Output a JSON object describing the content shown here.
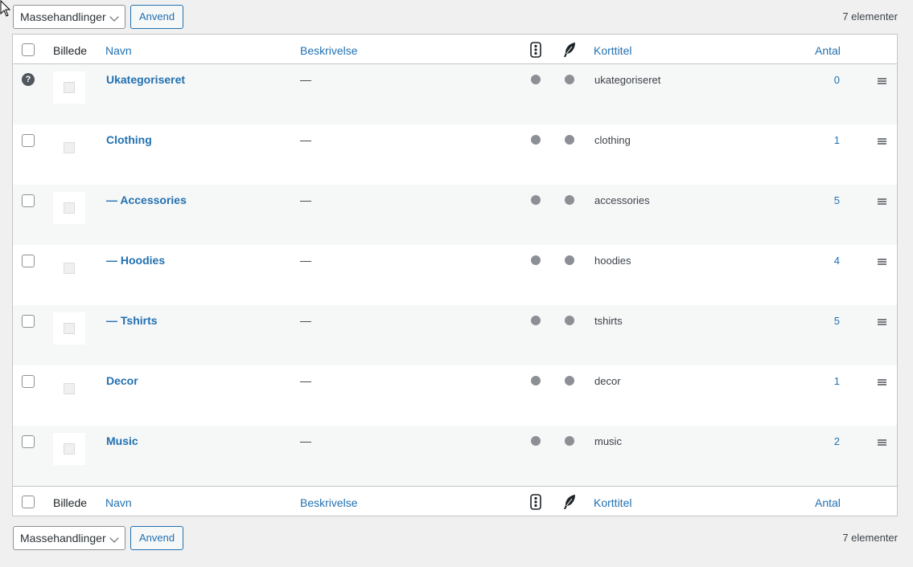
{
  "tablenav_top": {
    "bulk_actions": "Massehandlinger",
    "apply": "Anvend",
    "item_count": "7 elementer"
  },
  "tablenav_bottom": {
    "bulk_actions": "Massehandlinger",
    "apply": "Anvend",
    "item_count": "7 elementer"
  },
  "columns": {
    "image": "Billede",
    "name": "Navn",
    "description": "Beskrivelse",
    "slug": "Korttitel",
    "count": "Antal",
    "icon1": "traffic-light-icon",
    "icon2": "feather-icon"
  },
  "rows": [
    {
      "name": "Ukategoriseret",
      "description": "—",
      "slug": "ukategoriseret",
      "count": "0"
    },
    {
      "name": "Clothing",
      "description": "—",
      "slug": "clothing",
      "count": "1"
    },
    {
      "name": "— Accessories",
      "description": "—",
      "slug": "accessories",
      "count": "5"
    },
    {
      "name": "— Hoodies",
      "description": "—",
      "slug": "hoodies",
      "count": "4"
    },
    {
      "name": "— Tshirts",
      "description": "—",
      "slug": "tshirts",
      "count": "5"
    },
    {
      "name": "Decor",
      "description": "—",
      "slug": "decor",
      "count": "1"
    },
    {
      "name": "Music",
      "description": "—",
      "slug": "music",
      "count": "2"
    }
  ],
  "colors": {
    "link": "#2271b1",
    "border": "#c3c4c7",
    "alt_row": "#f6f7f7",
    "dot": "#8c8f94"
  }
}
